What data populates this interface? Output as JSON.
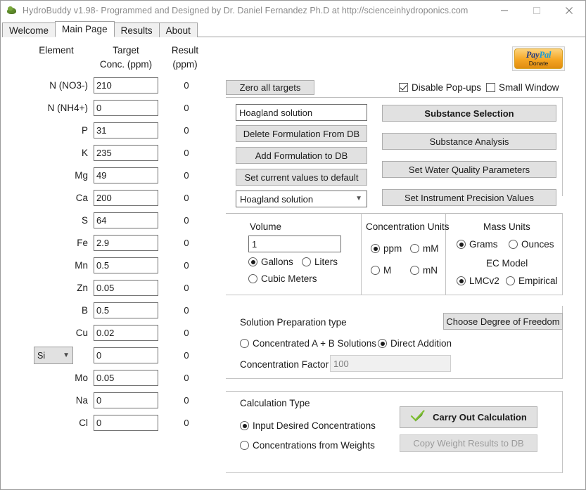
{
  "window": {
    "title": "HydroBuddy v1.98- Programmed and Designed by Dr. Daniel Fernandez Ph.D at http://scienceinhydroponics.com",
    "icon": "leaf-icon",
    "minimize": "–",
    "maximize": "□",
    "close": "✕"
  },
  "tabs": [
    {
      "label": "Welcome",
      "active": false
    },
    {
      "label": "Main Page",
      "active": true
    },
    {
      "label": "Results",
      "active": false
    },
    {
      "label": "About",
      "active": false
    }
  ],
  "table": {
    "headers": {
      "element": "Element",
      "target_line1": "Target",
      "target_line2": "Conc. (ppm)",
      "result_line1": "Result",
      "result_line2": "(ppm)"
    },
    "rows": [
      {
        "label": "N (NO3-)",
        "target": "210",
        "result": "0"
      },
      {
        "label": "N (NH4+)",
        "target": "0",
        "result": "0"
      },
      {
        "label": "P",
        "target": "31",
        "result": "0"
      },
      {
        "label": "K",
        "target": "235",
        "result": "0"
      },
      {
        "label": "Mg",
        "target": "49",
        "result": "0"
      },
      {
        "label": "Ca",
        "target": "200",
        "result": "0"
      },
      {
        "label": "S",
        "target": "64",
        "result": "0"
      },
      {
        "label": "Fe",
        "target": "2.9",
        "result": "0"
      },
      {
        "label": "Mn",
        "target": "0.5",
        "result": "0"
      },
      {
        "label": "Zn",
        "target": "0.05",
        "result": "0"
      },
      {
        "label": "B",
        "target": "0.5",
        "result": "0"
      },
      {
        "label": "Cu",
        "target": "0.02",
        "result": "0"
      },
      {
        "label": "Si",
        "target": "0",
        "result": "0",
        "is_select": true
      },
      {
        "label": "Mo",
        "target": "0.05",
        "result": "0"
      },
      {
        "label": "Na",
        "target": "0",
        "result": "0"
      },
      {
        "label": "Cl",
        "target": "0",
        "result": "0"
      }
    ]
  },
  "paypal": {
    "brand_pay": "Pay",
    "brand_pal": "Pal",
    "donate": "Donate"
  },
  "toolbar": {
    "zero_all_targets": "Zero all targets",
    "disable_popups": {
      "label": "Disable Pop-ups",
      "checked": true
    },
    "small_window": {
      "label": "Small Window",
      "checked": false
    }
  },
  "formulation": {
    "name_value": "Hoagland solution",
    "delete_button": "Delete Formulation From DB",
    "add_button": "Add Formulation to DB",
    "set_default_button": "Set current values to default",
    "selected_formulation": "Hoagland solution"
  },
  "actions": {
    "substance_selection": "Substance Selection",
    "substance_analysis": "Substance Analysis",
    "water_quality": "Set Water Quality Parameters",
    "instrument_precision": "Set Instrument Precision Values"
  },
  "volume": {
    "title": "Volume",
    "value": "1",
    "options": [
      {
        "label": "Gallons",
        "selected": true
      },
      {
        "label": "Liters",
        "selected": false
      },
      {
        "label": "Cubic Meters",
        "selected": false
      }
    ]
  },
  "concentration_units": {
    "title": "Concentration Units",
    "options": [
      {
        "label": "ppm",
        "selected": true
      },
      {
        "label": "mM",
        "selected": false
      },
      {
        "label": "M",
        "selected": false
      },
      {
        "label": "mN",
        "selected": false
      }
    ]
  },
  "mass_units": {
    "title": "Mass Units",
    "options": [
      {
        "label": "Grams",
        "selected": true
      },
      {
        "label": "Ounces",
        "selected": false
      }
    ]
  },
  "ec_model": {
    "title": "EC Model",
    "options": [
      {
        "label": "LMCv2",
        "selected": true
      },
      {
        "label": "Empirical",
        "selected": false
      }
    ]
  },
  "solution_prep": {
    "title": "Solution Preparation type",
    "options": [
      {
        "label": "Concentrated A + B Solutions",
        "selected": false
      },
      {
        "label": "Direct Addition",
        "selected": true
      }
    ],
    "factor_label": "Concentration Factor",
    "factor_value": "100",
    "degree_of_freedom_button": "Choose Degree of Freedom"
  },
  "calculation": {
    "title": "Calculation Type",
    "options": [
      {
        "label": "Input Desired Concentrations",
        "selected": true
      },
      {
        "label": "Concentrations from  Weights",
        "selected": false
      }
    ],
    "carry_out_button": "Carry Out Calculation",
    "copy_weight_button": "Copy Weight Results to DB"
  },
  "colors": {
    "button_face": "#e1e1e1",
    "button_border": "#adadad",
    "paypal_blue": "#253b80",
    "paypal_lightblue": "#179bd7",
    "paypal_orange": "#f5a623",
    "check_green": "#5a9a20",
    "title_text": "#8a8a8a"
  }
}
